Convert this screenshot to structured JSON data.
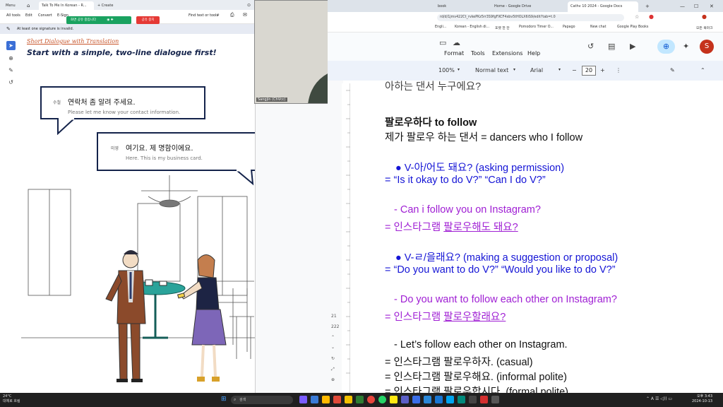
{
  "left_window": {
    "tabs": [
      "Menu",
      "Talk To Me In Korean - R...",
      "+ Create"
    ],
    "menu": [
      "All tools",
      "Edit",
      "Convert",
      "E-Sign"
    ],
    "find_text": "Find text or tools",
    "share_banner": "화면 공유 중입니다",
    "stop_share": "공유 중지",
    "signature_notice": "At least one signature is invalid.",
    "doc": {
      "subtitle": "Short Dialogue with Translation",
      "heading": "Start with a simple, two-line dialogue first!",
      "bubble1": {
        "speaker": "수철",
        "korean": "연락처 좀 알려 주세요.",
        "english": "Please let me know your contact information."
      },
      "bubble2": {
        "speaker": "미영",
        "korean": "여기요. 제 명함이에요.",
        "english": "Here. This is my business card."
      }
    }
  },
  "webcam": {
    "label": "Sangjin (ChVcc)"
  },
  "right_window": {
    "tabs": [
      {
        "label": "book"
      },
      {
        "label": "Home - Google Drive"
      },
      {
        "label": "Cathv 10 2024 - Google Docs",
        "active": true
      }
    ],
    "url": "rd/d/1jmv422Ct_rvkePKz5rr3S9fgFXCF4xbv5tHOLX6iS9/edit?tab=t.0",
    "bookmarks": [
      "Engli...",
      "Korean - English di...",
      "포켓 한 잔",
      "Pomodoro Timer O...",
      "Papago",
      "New chat",
      "Google Play Books",
      "모든 북마크"
    ],
    "docs_menu": [
      "Format",
      "Tools",
      "Extensions",
      "Help"
    ],
    "toolbar": {
      "zoom": "100%",
      "style": "Normal text",
      "font": "Arial",
      "font_size": "20"
    },
    "side_numbers": [
      "21",
      "222"
    ],
    "avatar_letter": "S",
    "doc_lines": [
      {
        "text": "팔로우하다 to follow",
        "color": "black",
        "bold": true
      },
      {
        "text": "제가 팔로우 하는 댄서 = dancers who I follow",
        "color": "black"
      },
      {
        "text": "●  V-아/어도 돼요? (asking permission)",
        "color": "blue",
        "indent": true
      },
      {
        "text": "=  “Is it okay to do V?” “Can I do V?”",
        "color": "blue"
      },
      {
        "text": "-  Can i follow you on Instagram?",
        "color": "purple",
        "indent": true
      },
      {
        "text": "= 인스타그램 ",
        "color": "purple",
        "u": "팔로우해도 돼요?"
      },
      {
        "text": "●  V-ㄹ/을래요? (making a suggestion or proposal)",
        "color": "blue",
        "indent": true
      },
      {
        "text": "=  “Do you want to do V?” “Would you like to do V?”",
        "color": "blue"
      },
      {
        "text": "-  Do you want to follow each other on Instagram?",
        "color": "purple",
        "indent": true
      },
      {
        "text": "= 인스타그램 ",
        "color": "purple",
        "u": "팔로우할래요?"
      },
      {
        "text": "-  Let’s follow each other on Instagram.",
        "color": "black",
        "indent": true
      },
      {
        "text": "= 인스타그램 팔로우하자. (casual)",
        "color": "black"
      },
      {
        "text": "= 인스타그램 팔로우해요. (informal polite)",
        "color": "black"
      },
      {
        "text": "= 인스타그램 팔로우합시다. (formal polite)",
        "color": "black"
      }
    ]
  },
  "taskbar": {
    "weather_temp": "24°C",
    "weather_desc": "대체로 흐림",
    "search_placeholder": "검색",
    "time": "오후 3:43",
    "date": "2024-10-13"
  },
  "colors": {
    "accent_green": "#1aa260",
    "doc_blue": "#1515d6",
    "doc_purple": "#a020d4",
    "heading_navy": "#14234b",
    "subtitle_orange": "#c8552a"
  }
}
